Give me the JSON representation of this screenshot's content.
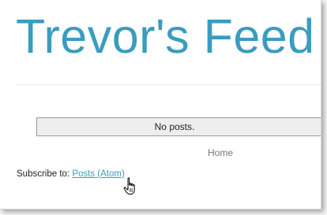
{
  "blog": {
    "title": "Trevor's Feed"
  },
  "posts": {
    "empty_message": "No posts."
  },
  "nav": {
    "home_label": "Home"
  },
  "subscribe": {
    "label": "Subscribe to:",
    "link_label": "Posts (Atom)"
  },
  "cursor": {
    "icon": "hand-pointer-icon"
  },
  "colors": {
    "accent": "#3a9cc0",
    "text": "#222222",
    "muted": "#777777"
  }
}
